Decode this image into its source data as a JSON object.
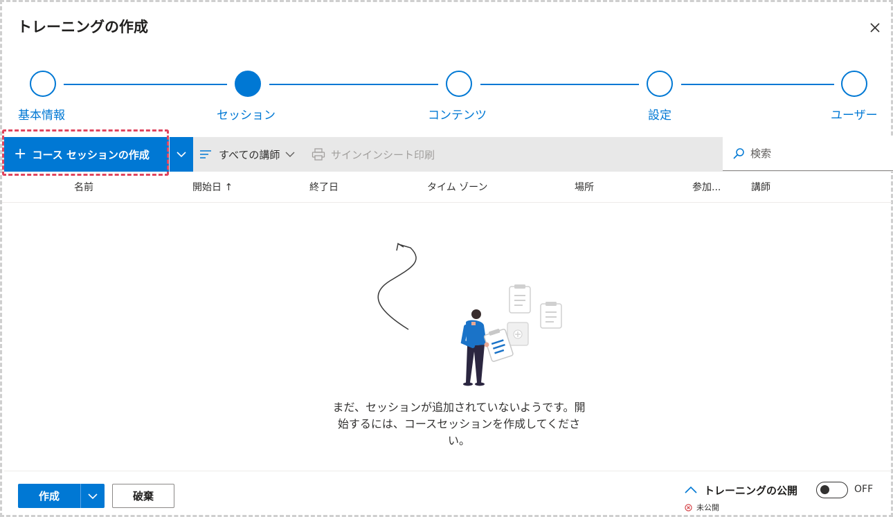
{
  "dialog": {
    "title": "トレーニングの作成"
  },
  "stepper": {
    "steps": [
      {
        "label": "基本情報",
        "state": "done"
      },
      {
        "label": "セッション",
        "state": "active"
      },
      {
        "label": "コンテンツ",
        "state": "pending"
      },
      {
        "label": "設定",
        "state": "pending"
      },
      {
        "label": "ユーザー",
        "state": "pending"
      }
    ]
  },
  "toolbar": {
    "create_label": "コース セッションの作成",
    "filter_label": "すべての講師",
    "print_label": "サインインシート印刷",
    "search_placeholder": "検索"
  },
  "table": {
    "columns": [
      "名前",
      "開始日 ↑",
      "終了日",
      "タイム ゾーン",
      "場所",
      "参加...",
      "講師"
    ]
  },
  "empty_state": {
    "message": "まだ、セッションが追加されていないようです。開始するには、コースセッションを作成してください。"
  },
  "footer": {
    "create_label": "作成",
    "discard_label": "破棄",
    "publish_label": "トレーニングの公開",
    "status_label": "未公開",
    "toggle_label": "OFF"
  },
  "colors": {
    "accent": "#0078d4",
    "highlight": "#e0455f"
  }
}
